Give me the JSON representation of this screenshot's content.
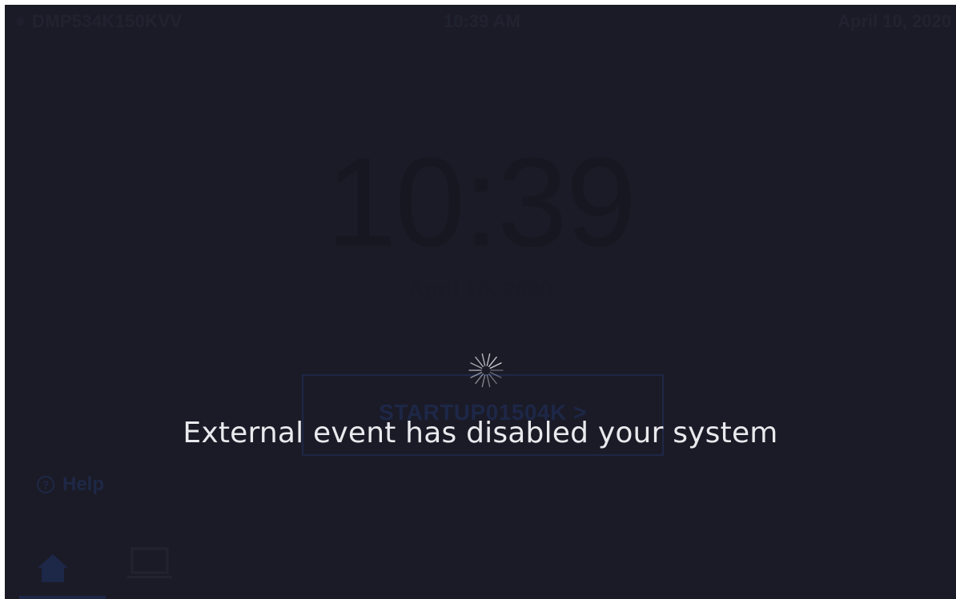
{
  "status_bar": {
    "device_name": "DMP534K150KVV",
    "time": "10:39 AM",
    "date": "April 10, 2020"
  },
  "home": {
    "clock": "10:39",
    "date": "April 10, 2020",
    "startup_button": "STARTUP01504K >",
    "help_label": "Help",
    "help_icon_glyph": "?"
  },
  "nav": {
    "items": [
      {
        "icon": "home-icon",
        "active": true
      },
      {
        "icon": "laptop-icon",
        "active": false
      }
    ]
  },
  "overlay": {
    "message": "External event has disabled your system",
    "spinner": "loading-spinner-icon"
  },
  "colors": {
    "background": "#1b1b27",
    "dim_text": "#20232f",
    "accent_dim": "#1d2747",
    "message_text": "#e9e9ee"
  }
}
